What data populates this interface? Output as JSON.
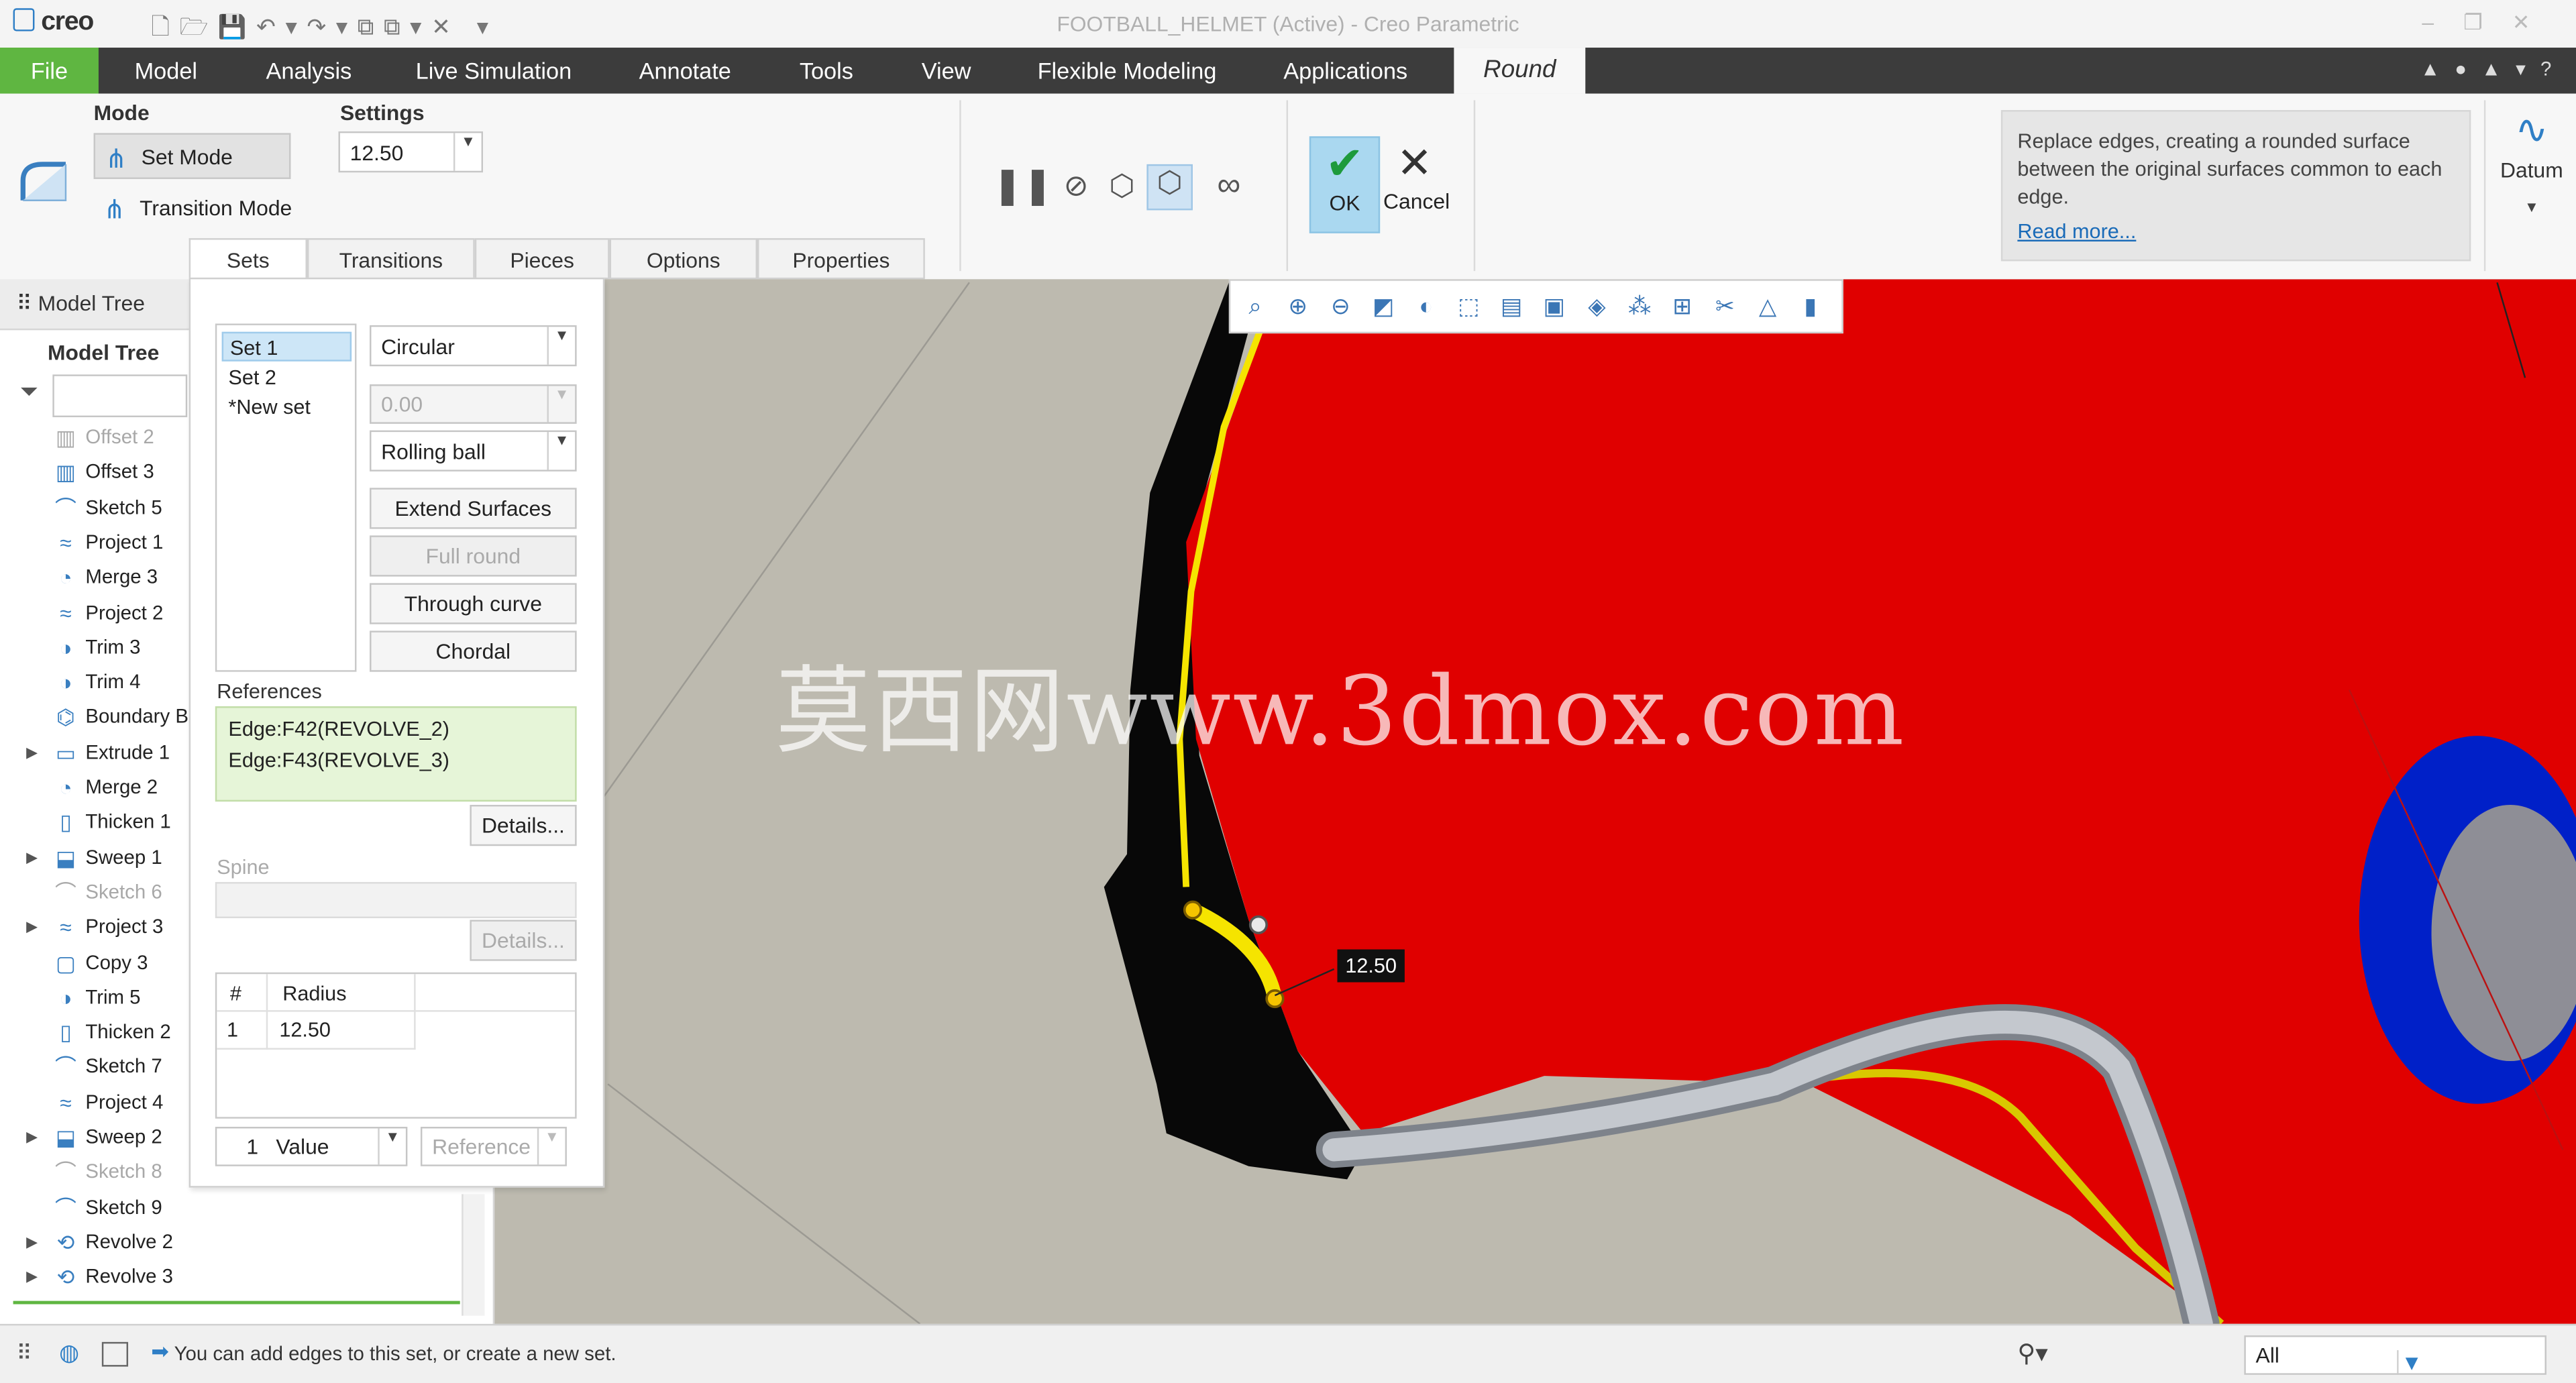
{
  "window": {
    "title": "FOOTBALL_HELMET (Active) - Creo Parametric",
    "brand": "creo"
  },
  "ribbon_tabs": [
    "File",
    "Model",
    "Analysis",
    "Live Simulation",
    "Annotate",
    "Tools",
    "View",
    "Flexible Modeling",
    "Applications",
    "Round"
  ],
  "mode": {
    "label": "Mode",
    "set_mode": "Set Mode",
    "transition_mode": "Transition Mode"
  },
  "settings": {
    "label": "Settings",
    "radius_value": "12.50"
  },
  "sub_tabs": [
    "Sets",
    "Transitions",
    "Pieces",
    "Options",
    "Properties"
  ],
  "actions": {
    "ok": "OK",
    "cancel": "Cancel",
    "datum": "Datum"
  },
  "help": {
    "text": "Replace edges, creating a rounded surface between the original surfaces common to each edge.",
    "link": "Read more..."
  },
  "left_panel": {
    "tab_label": "Model Tree",
    "header": "Model Tree",
    "items": [
      {
        "label": "Offset 2",
        "icon": "offset-icon",
        "dim": true,
        "expandable": false
      },
      {
        "label": "Offset 3",
        "icon": "offset-icon",
        "dim": false,
        "expandable": false
      },
      {
        "label": "Sketch 5",
        "icon": "sketch-icon",
        "dim": false,
        "expandable": false
      },
      {
        "label": "Project 1",
        "icon": "project-icon",
        "dim": false,
        "expandable": false
      },
      {
        "label": "Merge 3",
        "icon": "merge-icon",
        "dim": false,
        "expandable": false
      },
      {
        "label": "Project 2",
        "icon": "project-icon",
        "dim": false,
        "expandable": false
      },
      {
        "label": "Trim 3",
        "icon": "trim-icon",
        "dim": false,
        "expandable": false
      },
      {
        "label": "Trim 4",
        "icon": "trim-icon",
        "dim": false,
        "expandable": false
      },
      {
        "label": "Boundary Ble",
        "icon": "boundary-blend-icon",
        "dim": false,
        "expandable": false
      },
      {
        "label": "Extrude 1",
        "icon": "extrude-icon",
        "dim": false,
        "expandable": true
      },
      {
        "label": "Merge 2",
        "icon": "merge-icon",
        "dim": false,
        "expandable": false
      },
      {
        "label": "Thicken 1",
        "icon": "thicken-icon",
        "dim": false,
        "expandable": false
      },
      {
        "label": "Sweep 1",
        "icon": "sweep-icon",
        "dim": false,
        "expandable": true
      },
      {
        "label": "Sketch 6",
        "icon": "sketch-icon",
        "dim": true,
        "expandable": false
      },
      {
        "label": "Project 3",
        "icon": "project-icon",
        "dim": false,
        "expandable": true
      },
      {
        "label": "Copy 3",
        "icon": "copy-icon",
        "dim": false,
        "expandable": false
      },
      {
        "label": "Trim 5",
        "icon": "trim-icon",
        "dim": false,
        "expandable": false
      },
      {
        "label": "Thicken 2",
        "icon": "thicken-icon",
        "dim": false,
        "expandable": false
      },
      {
        "label": "Sketch 7",
        "icon": "sketch-icon",
        "dim": false,
        "expandable": false
      },
      {
        "label": "Project 4",
        "icon": "project-icon",
        "dim": false,
        "expandable": false
      },
      {
        "label": "Sweep 2",
        "icon": "sweep-icon",
        "dim": false,
        "expandable": true
      },
      {
        "label": "Sketch 8",
        "icon": "sketch-icon",
        "dim": true,
        "expandable": false
      },
      {
        "label": "Sketch 9",
        "icon": "sketch-icon",
        "dim": false,
        "expandable": false
      },
      {
        "label": "Revolve 2",
        "icon": "revolve-icon",
        "dim": false,
        "expandable": true
      },
      {
        "label": "Revolve 3",
        "icon": "revolve-icon",
        "dim": false,
        "expandable": true
      }
    ]
  },
  "sets_panel": {
    "sets": [
      "Set 1",
      "Set 2",
      "*New set"
    ],
    "shape": "Circular",
    "shape_value": "0.00",
    "method": "Rolling ball",
    "buttons": [
      "Extend Surfaces",
      "Full round",
      "Through curve",
      "Chordal"
    ],
    "references_label": "References",
    "references": [
      "Edge:F42(REVOLVE_2)",
      "Edge:F43(REVOLVE_3)"
    ],
    "details": "Details...",
    "spine_label": "Spine",
    "spine_details": "Details...",
    "radius_table": {
      "col_num": "#",
      "col_radius": "Radius",
      "rows": [
        {
          "num": "1",
          "radius": "12.50"
        }
      ]
    },
    "footer_num": "1",
    "footer_value": "Value",
    "footer_reference": "Reference"
  },
  "viewport": {
    "dimension_label": "12.50",
    "watermark": "莫西网www.3dmox.com",
    "colors": {
      "shell": "#e00000",
      "background": "#bdbaaf",
      "highlight": "#f5e400",
      "earhole": "#0018c0"
    }
  },
  "status": {
    "message": "You can add edges to this set, or create a new set.",
    "filter": "All"
  }
}
